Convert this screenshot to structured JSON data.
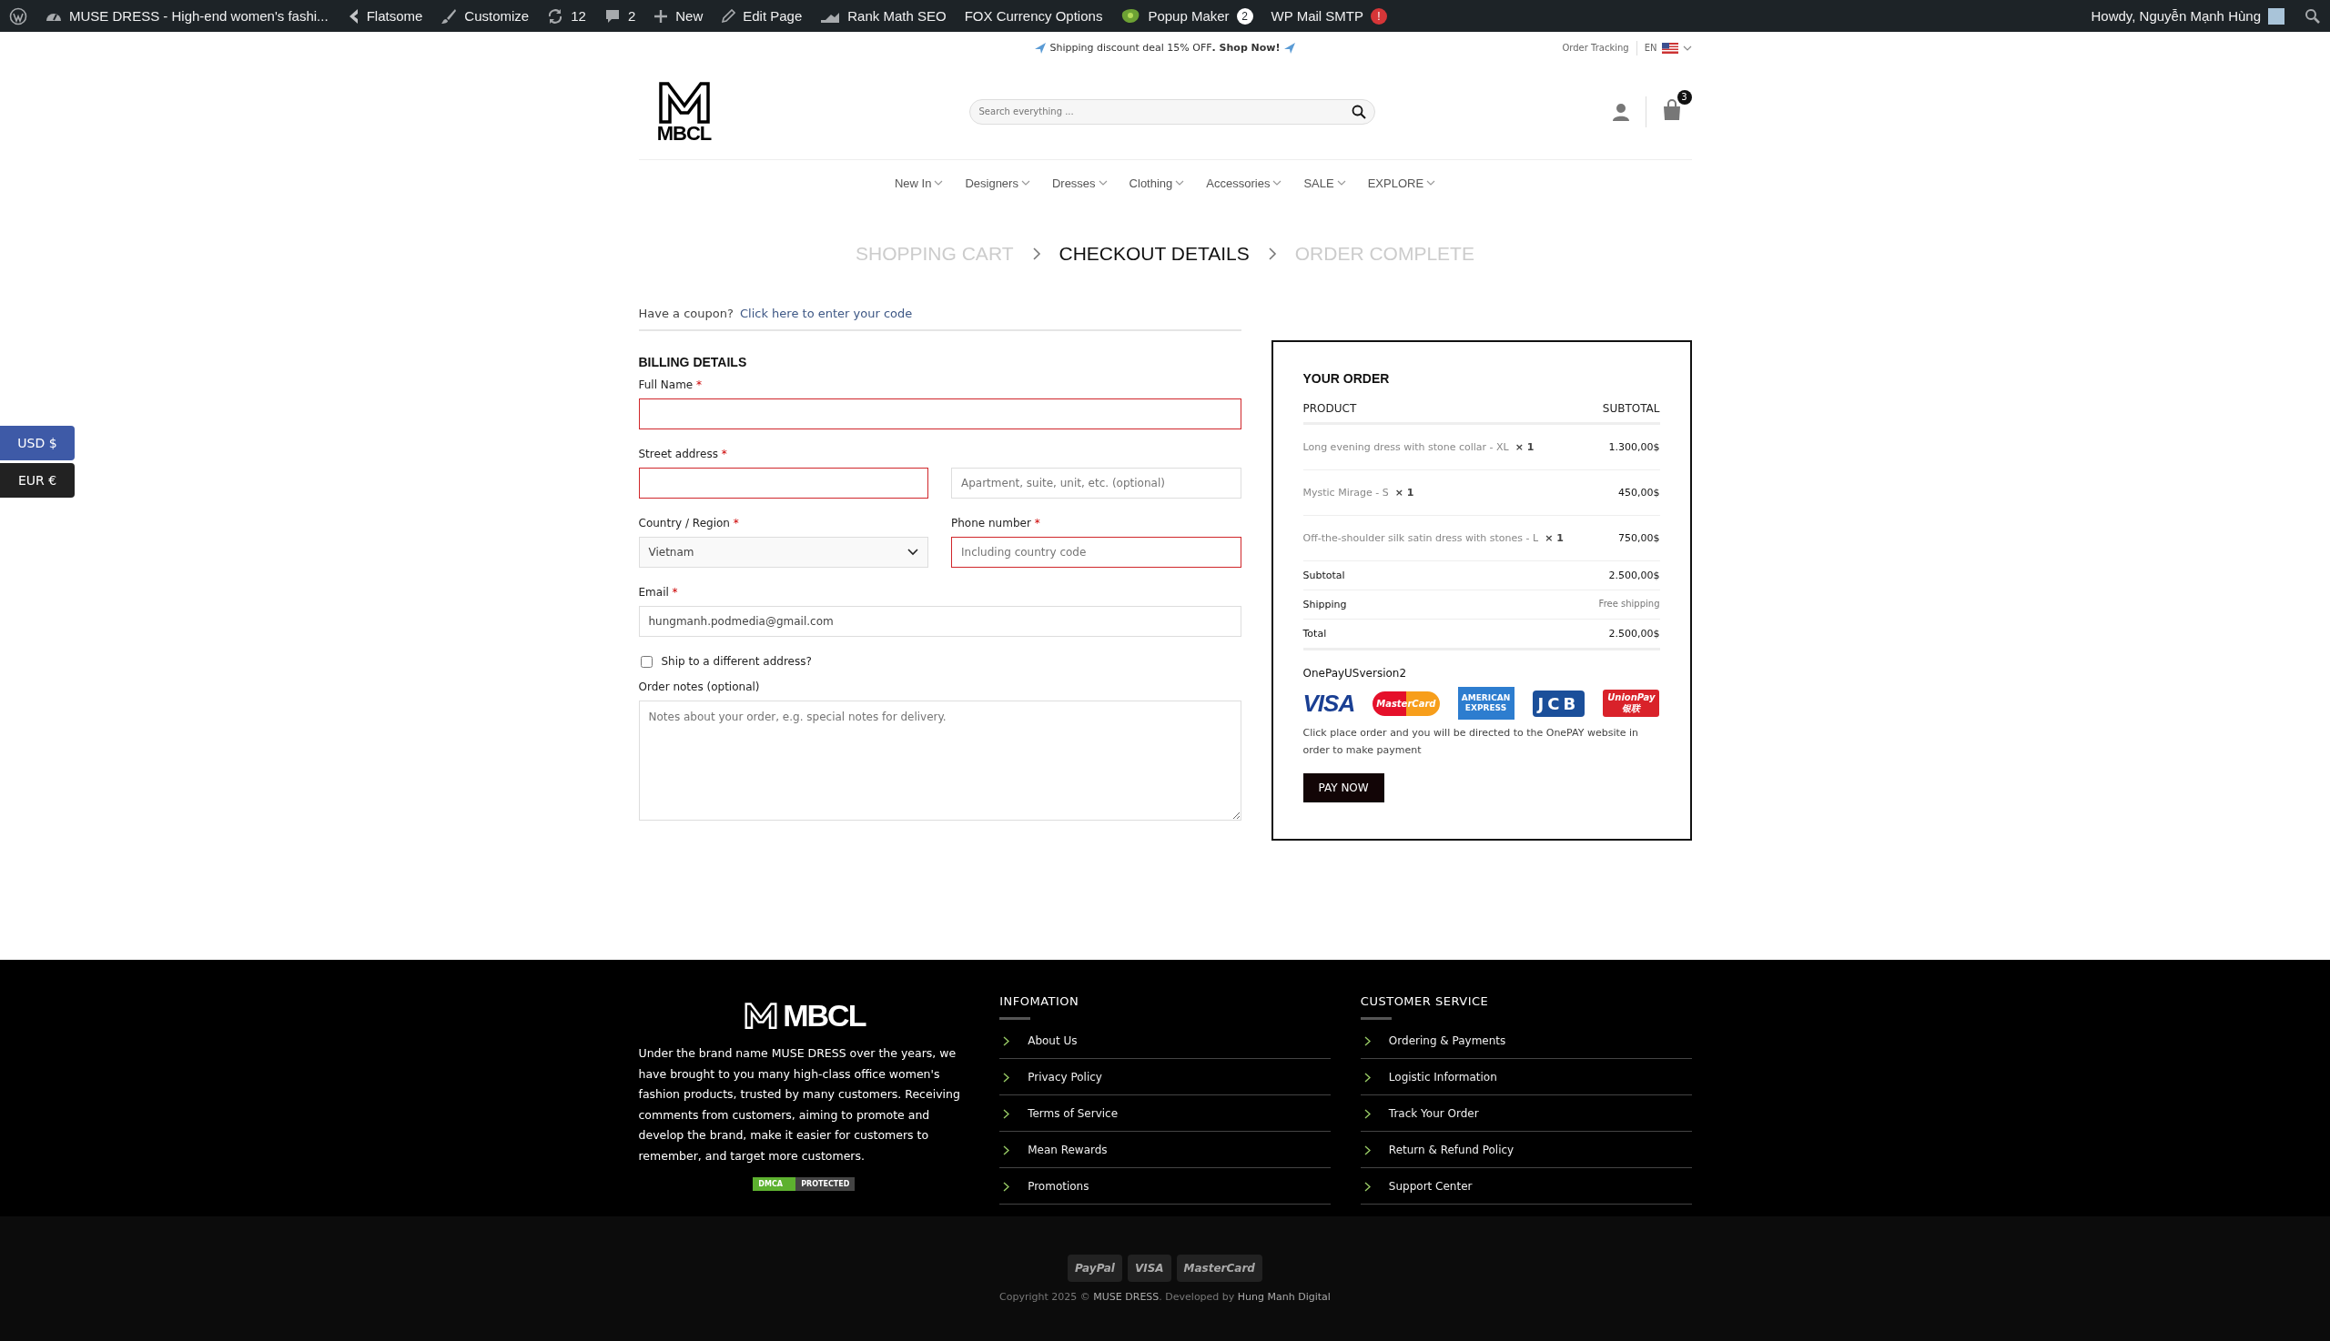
{
  "admin_bar": {
    "items": [
      {
        "kind": "wp"
      },
      {
        "kind": "site",
        "label": "MUSE DRESS - High-end women's fashi..."
      },
      {
        "kind": "theme",
        "label": "Flatsome"
      },
      {
        "kind": "customize",
        "label": "Customize"
      },
      {
        "kind": "updates",
        "label": "12"
      },
      {
        "kind": "comments",
        "label": "2"
      },
      {
        "kind": "new",
        "label": "New"
      },
      {
        "kind": "edit",
        "label": "Edit Page"
      },
      {
        "kind": "seo",
        "label": "Rank Math SEO"
      },
      {
        "kind": "plain",
        "label": "FOX Currency Options"
      },
      {
        "kind": "popup",
        "label": "Popup Maker",
        "badge": {
          "kind": "count",
          "text": "2"
        }
      },
      {
        "kind": "plain",
        "label": "WP Mail SMTP",
        "badge": {
          "kind": "alert",
          "text": "!"
        }
      }
    ],
    "greeting": "Howdy, Nguyễn Mạnh Hùng"
  },
  "top_bar": {
    "promo": "Shipping discount deal 15% OFF**. Shop Now!**",
    "order_tracking": "Order Tracking",
    "language": "EN"
  },
  "header": {
    "logo_text": "MBCL",
    "search": {
      "placeholder": "Search everything ..."
    },
    "cart_count": "3"
  },
  "nav": [
    "New In",
    "Designers",
    "Dresses",
    "Clothing",
    "Accessories",
    "SALE",
    "EXPLORE"
  ],
  "steps": [
    {
      "label": "SHOPPING CART",
      "selected": false
    },
    {
      "label": "CHECKOUT DETAILS",
      "selected": true
    },
    {
      "label": "ORDER COMPLETE",
      "selected": false
    }
  ],
  "coupon": {
    "text": "Have a coupon?",
    "link": "Click here to enter your code"
  },
  "billing": {
    "title": "BILLING DETAILS",
    "rows": [
      [
        {
          "kind": "text",
          "label": "Full Name",
          "required_mark": "*",
          "invalid": true
        }
      ],
      [
        {
          "kind": "text",
          "label": "Street address",
          "required_mark": "*",
          "invalid": true
        },
        {
          "kind": "text",
          "placeholder": "Apartment, suite, unit, etc. (optional)",
          "invalid": false
        }
      ],
      [
        {
          "kind": "select",
          "label": "Country / Region",
          "required_mark": "*",
          "value": "Vietnam",
          "invalid": false
        },
        {
          "kind": "text",
          "label": "Phone number",
          "required_mark": "*",
          "placeholder": "Including country code",
          "invalid": true
        }
      ],
      [
        {
          "kind": "text",
          "label": "Email",
          "required_mark": "*",
          "value": "hungmanh.podmedia@gmail.com",
          "invalid": false
        }
      ]
    ],
    "ship_different": {
      "label": "Ship to a different address?",
      "checked": false
    },
    "notes": {
      "label": "Order notes (optional)",
      "placeholder": "Notes about your order, e.g. special notes for delivery."
    }
  },
  "order": {
    "title": "YOUR ORDER",
    "columns": [
      "PRODUCT",
      "SUBTOTAL"
    ],
    "items": [
      {
        "name": "Long evening dress with stone collar - XL",
        "qty": "× 1",
        "price": "1.300,00$"
      },
      {
        "name": "Mystic Mirage - S",
        "qty": "× 1",
        "price": "450,00$"
      },
      {
        "name": "Off-the-shoulder silk satin dress with stones - L",
        "qty": "× 1",
        "price": "750,00$"
      }
    ],
    "totals": [
      {
        "kind": "subtotal",
        "label": "Subtotal",
        "value": "2.500,00$"
      },
      {
        "kind": "shipping",
        "label": "Shipping",
        "value": "Free shipping"
      },
      {
        "kind": "total",
        "label": "Total",
        "value": "2.500,00$"
      }
    ],
    "payment_method": "OnePayUSversion2",
    "card_logos": [
      {
        "kind": "visa",
        "text": "VISA"
      },
      {
        "kind": "mastercard",
        "text": "MasterCard"
      },
      {
        "kind": "amex",
        "text": "AMERICAN EXPRESS"
      },
      {
        "kind": "jcb",
        "text": "JCB"
      },
      {
        "kind": "unionpay",
        "text": "UnionPay",
        "sub": "银联"
      }
    ],
    "payment_note": "Click place order and you will be directed to the OnePAY website in order to make payment",
    "button": "PAY NOW"
  },
  "currency_switcher": [
    {
      "label": "USD $",
      "selected": true
    },
    {
      "label": "EUR €",
      "selected": false
    }
  ],
  "footer": {
    "logo_text": "MBCL",
    "about": "Under the brand name MUSE DRESS over the years, we have brought to you many high-class office women's fashion products, trusted by many customers. Receiving comments from customers, aiming to promote and develop the brand, make it easier for customers to remember, and target more customers.",
    "dmca": {
      "left": "DMCA",
      "right": "PROTECTED"
    },
    "columns": [
      {
        "title": "INFOMATION",
        "links": [
          "About Us",
          "Privacy Policy",
          "Terms of Service",
          "Mean Rewards",
          "Promotions"
        ]
      },
      {
        "title": "CUSTOMER SERVICE",
        "links": [
          "Ordering & Payments",
          "Logistic Information",
          "Track Your Order",
          "Return & Refund Policy",
          "Support Center"
        ]
      }
    ],
    "payment_logos": [
      "PayPal",
      "VISA",
      "MasterCard"
    ],
    "copyright": {
      "prefix": "Copyright 2025 ©",
      "brand": "MUSE DRESS",
      "middle": ". Developed by",
      "developer": "Hung Manh Digital"
    }
  }
}
